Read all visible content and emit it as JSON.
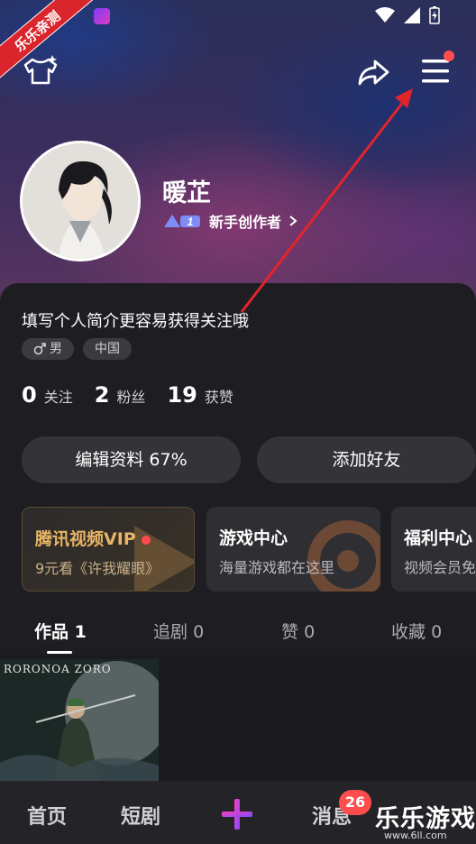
{
  "status_bar": {
    "watermark_ribbon": "乐乐亲测"
  },
  "profile": {
    "username": "暖芷",
    "level_number": "1",
    "level_label": "新手创作者",
    "bio": "填写个人简介更容易获得关注哦",
    "gender_tag": "男",
    "region_tag": "中国",
    "stats": [
      {
        "value": "0",
        "label": "关注"
      },
      {
        "value": "2",
        "label": "粉丝"
      },
      {
        "value": "19",
        "label": "获赞"
      }
    ]
  },
  "actions": {
    "edit_label": "编辑资料 67%",
    "add_friend_label": "添加好友"
  },
  "cards": [
    {
      "title": "腾讯视频VIP",
      "subtitle": "9元看《许我耀眼》"
    },
    {
      "title": "游戏中心",
      "subtitle": "海量游戏都在这里"
    },
    {
      "title": "福利中心",
      "subtitle": "视频会员免"
    }
  ],
  "tabs": [
    {
      "label": "作品",
      "count": "1"
    },
    {
      "label": "追剧",
      "count": "0"
    },
    {
      "label": "赞",
      "count": "0"
    },
    {
      "label": "收藏",
      "count": "0"
    }
  ],
  "works": [
    {
      "title": "RORONOA ZORO"
    }
  ],
  "bottom_nav": {
    "home": "首页",
    "shorts": "短剧",
    "messages": "消息",
    "message_badge": "26"
  },
  "watermark": {
    "text": "乐乐游戏",
    "url": "www.6ll.com"
  },
  "colors": {
    "accent_red": "#ff4d4d",
    "vip_gold": "#e8b564",
    "panel_bg": "#1e1e22"
  }
}
